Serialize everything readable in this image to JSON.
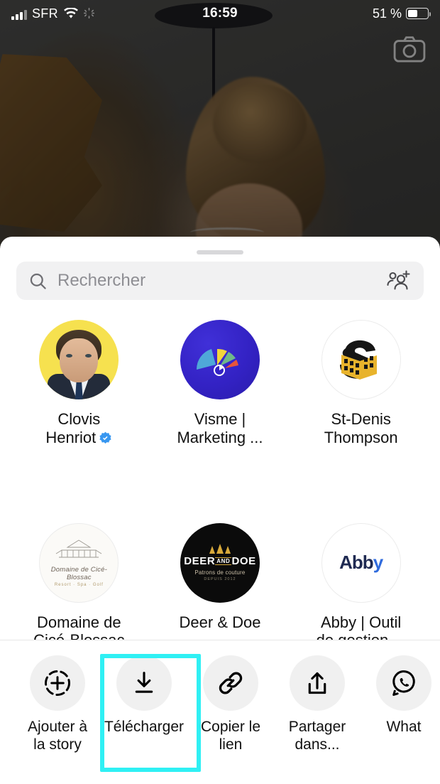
{
  "status_bar": {
    "carrier": "SFR",
    "time": "16:59",
    "battery_text": "51 %",
    "battery_percent": 51,
    "icons": [
      "signal-bars-icon",
      "wifi-icon",
      "sync-icon",
      "battery-icon"
    ]
  },
  "background": {
    "camera_icon": "camera-icon"
  },
  "sheet": {
    "grabber": "sheet-grabber",
    "search": {
      "placeholder": "Rechercher",
      "value": "",
      "search_icon": "search-icon",
      "add_people_icon": "add-people-icon"
    },
    "contacts": [
      {
        "name": "Clovis Henriot",
        "name_line1": "Clovis",
        "name_line2": "Henriot",
        "verified": true,
        "avatar": "clovis-portrait-avatar"
      },
      {
        "name": "Visme | Marketing ...",
        "name_line1": "Visme |",
        "name_line2": "Marketing ...",
        "verified": false,
        "avatar": "visme-logo-avatar"
      },
      {
        "name": "St-Denis Thompson",
        "name_line1": "St-Denis",
        "name_line2": "Thompson",
        "verified": false,
        "avatar": "st-denis-thompson-logo-avatar"
      },
      {
        "name": "Domaine de Cicé-Blossac",
        "name_line1": "Domaine de",
        "name_line2": "Cicé-Blossac",
        "verified": false,
        "avatar": "domaine-de-cice-blossac-logo-avatar"
      },
      {
        "name": "Deer & Doe",
        "name_line1": "Deer & Doe",
        "name_line2": "",
        "verified": false,
        "avatar": "deer-and-doe-logo-avatar"
      },
      {
        "name": "Abby | Outil de gestion ...",
        "name_line1": "Abby | Outil",
        "name_line2": "de gestion ...",
        "verified": false,
        "avatar": "abby-logo-avatar"
      }
    ],
    "avatar_art": {
      "deer": {
        "title": "DEER",
        "and": "AND",
        "title2": "DOE",
        "subtitle": "Patrons de couture",
        "since": "DEPUIS 2012"
      },
      "domaine": {
        "name": "Domaine de Cicé-Blossac",
        "subtitle": "Resort · Spa · Golf"
      },
      "abby": {
        "text": "Abb",
        "accent": "y"
      }
    }
  },
  "actions": [
    {
      "label_line1": "Ajouter à",
      "label_line2": "la story",
      "icon": "add-to-story-icon",
      "highlighted": false
    },
    {
      "label_line1": "Télécharger",
      "label_line2": "",
      "icon": "download-icon",
      "highlighted": true
    },
    {
      "label_line1": "Copier le lien",
      "label_line2": "",
      "icon": "link-icon",
      "highlighted": false
    },
    {
      "label_line1": "Partager",
      "label_line2": "dans...",
      "icon": "share-icon",
      "highlighted": false
    },
    {
      "label_line1": "What",
      "label_line2": "",
      "icon": "whatsapp-icon",
      "highlighted": false
    }
  ],
  "colors": {
    "highlight": "#2ff0f4",
    "verified_blue": "#3897f0",
    "sheet_background": "#ffffff",
    "search_background": "#f1f1f2",
    "action_circle": "#f0f0f0",
    "avatar_yellow": "#f6e14f",
    "visme_blue": "#3322c4",
    "stdenis_gold": "#e8b32c",
    "deer_black": "#0b0b0b",
    "abby_navy": "#1f2a52"
  }
}
